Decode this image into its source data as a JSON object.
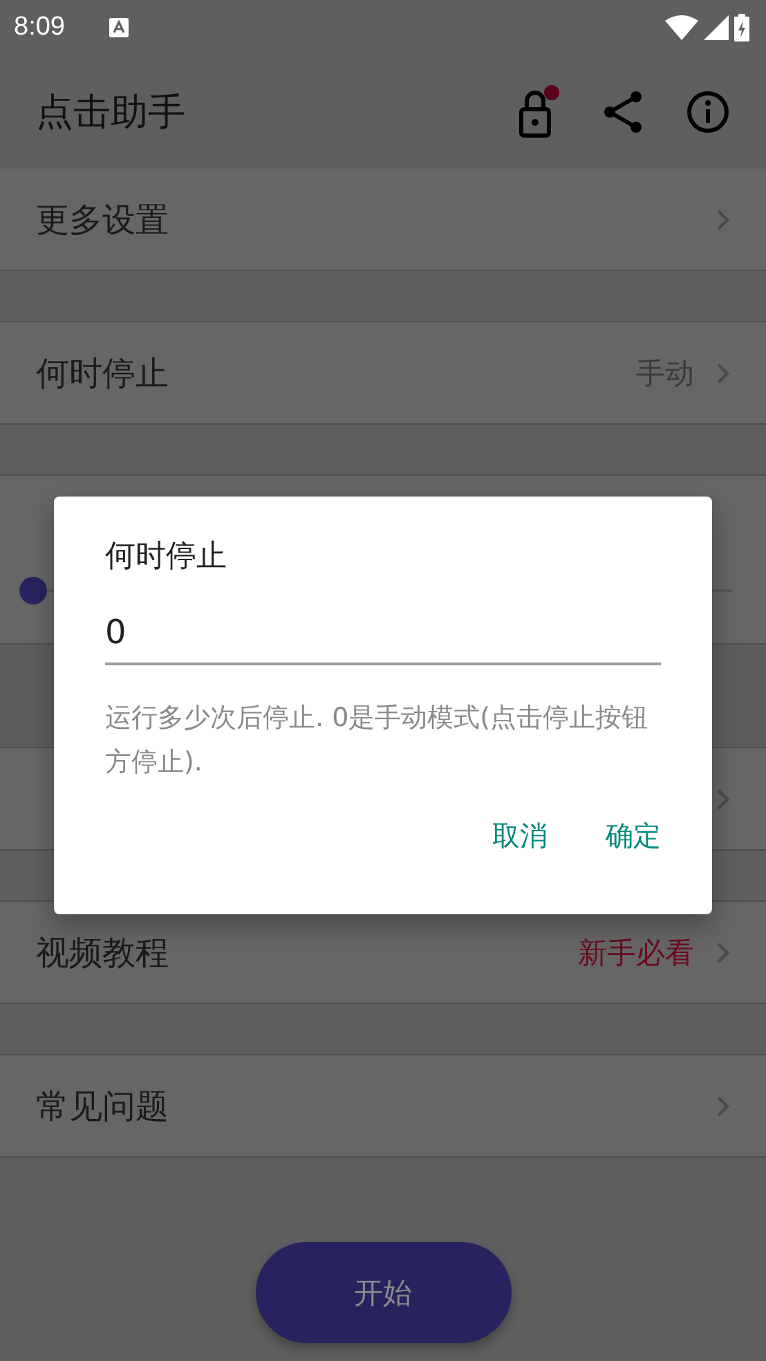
{
  "status_bar": {
    "time": "8:09"
  },
  "app_bar": {
    "title": "点击助手",
    "lock_badge": true
  },
  "settings": [
    {
      "kind": "row",
      "label": "更多设置"
    },
    {
      "kind": "gap"
    },
    {
      "kind": "row",
      "label": "何时停止",
      "value": "手动",
      "accent": false
    },
    {
      "kind": "gap"
    },
    {
      "kind": "slider",
      "level": 0
    },
    {
      "kind": "caption"
    },
    {
      "kind": "row"
    },
    {
      "kind": "gap"
    },
    {
      "kind": "row",
      "label": "视频教程",
      "value": "新手必看",
      "accent": true
    },
    {
      "kind": "gap"
    },
    {
      "kind": "row",
      "label": "常见问题"
    }
  ],
  "start_button": {
    "label": "开始"
  },
  "dialog": {
    "title": "何时停止",
    "input_value": "0",
    "help": "运行多少次后停止. 0是手动模式(点击停止按钮方停止).",
    "buttons": [
      "取消",
      "确定"
    ]
  }
}
